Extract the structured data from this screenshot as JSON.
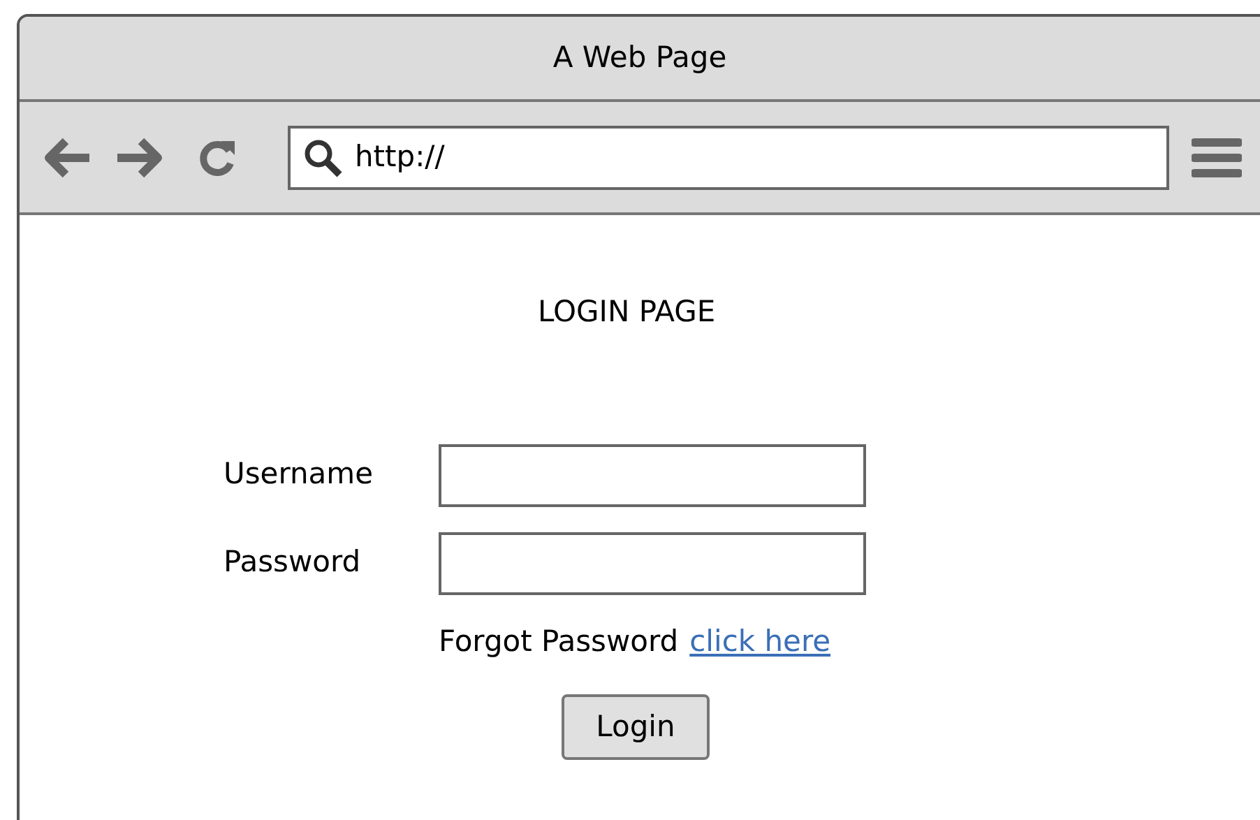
{
  "window": {
    "title": "A Web Page"
  },
  "address_bar": {
    "value": "http://"
  },
  "page": {
    "heading": "LOGIN PAGE",
    "fields": [
      {
        "label": "Username"
      },
      {
        "label": "Password"
      }
    ],
    "forgot": {
      "text": "Forgot Password",
      "link": "click here"
    },
    "button": "Login"
  }
}
